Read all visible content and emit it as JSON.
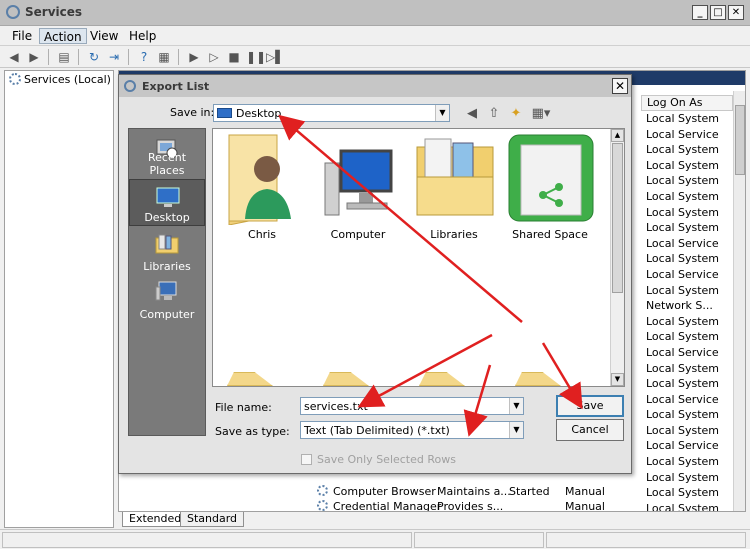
{
  "window": {
    "title": "Services"
  },
  "menu": [
    "File",
    "Action",
    "View",
    "Help"
  ],
  "tree": {
    "root": "Services (Local)"
  },
  "services": {
    "column_logon": "Log On As",
    "logon_values": [
      "Local System",
      "Local Service",
      "Local System",
      "Local System",
      "Local System",
      "Local System",
      "Local System",
      "Local System",
      "Local Service",
      "Local System",
      "Local Service",
      "Local System",
      "Network S...",
      "Local System",
      "Local System",
      "Local Service",
      "Local System",
      "Local System",
      "Local Service",
      "Local System",
      "Local System",
      "Local Service",
      "Local System",
      "Local System",
      "Local System",
      "Local System",
      "Local System"
    ],
    "rows": [
      {
        "name": "Computer Browser",
        "description": "Maintains a...",
        "status": "Started",
        "startup": "Manual"
      },
      {
        "name": "Credential Manager",
        "description": "Provides s...",
        "status": "",
        "startup": "Manual"
      }
    ]
  },
  "tabs": [
    "Extended",
    "Standard"
  ],
  "dialog": {
    "title": "Export List",
    "save_in_label": "Save in:",
    "save_in_value": "Desktop",
    "places": [
      "Recent Places",
      "Desktop",
      "Libraries",
      "Computer"
    ],
    "files": [
      "Chris",
      "Computer",
      "Libraries",
      "Shared Space"
    ],
    "filename_label": "File name:",
    "filename_value": "services.txt",
    "type_label": "Save as type:",
    "type_value": "Text (Tab Delimited) (*.txt)",
    "save_button": "Save",
    "cancel_button": "Cancel",
    "checkbox_label": "Save Only Selected Rows",
    "close": "✕"
  },
  "colors": {
    "annotation_arrow": "#e02020",
    "header_bar": "#1f3b68",
    "default_button_border": "#3c7fb1"
  }
}
